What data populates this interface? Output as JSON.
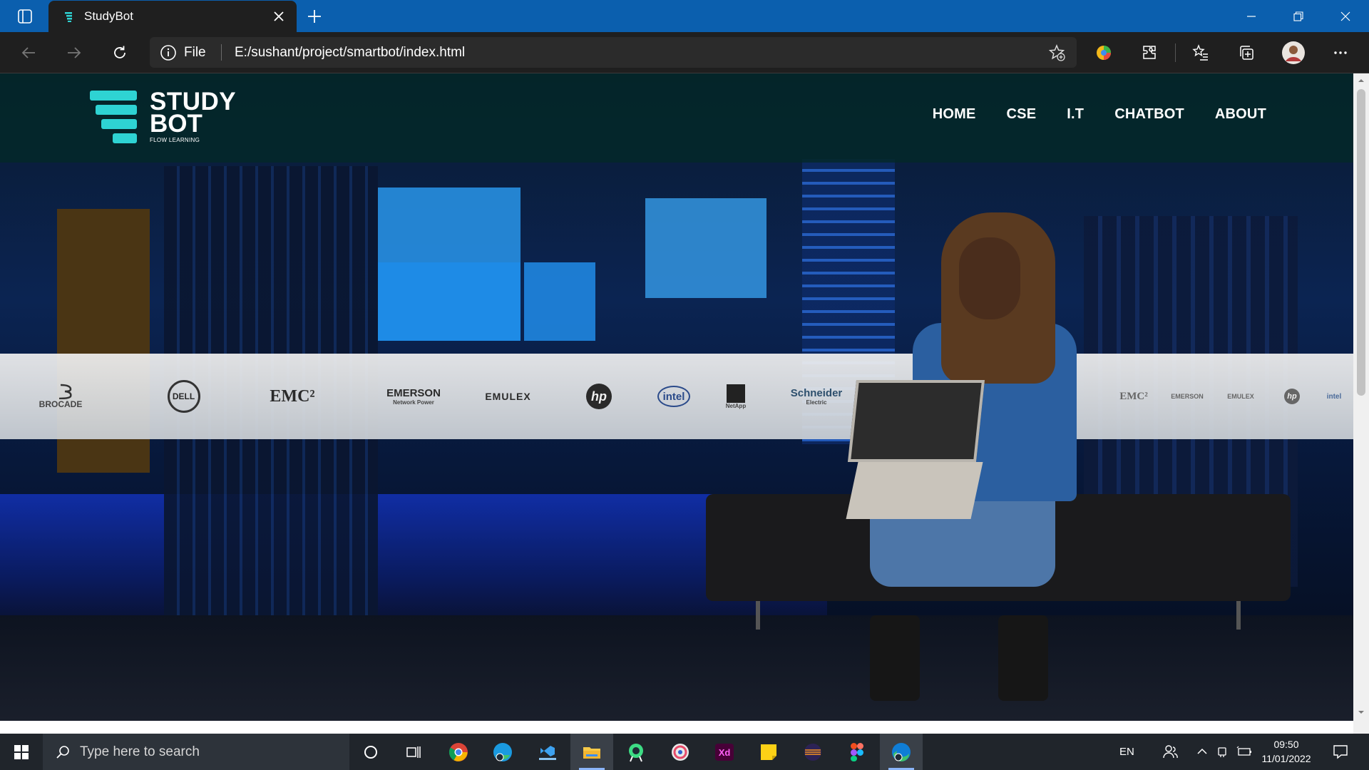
{
  "browser": {
    "tab_title": "StudyBot",
    "site_info_label": "File",
    "url": "E:/sushant/project/smartbot/index.html"
  },
  "site": {
    "logo": {
      "line1": "STUDY",
      "line2": "BOT",
      "tagline": "FLOW LEARNING",
      "accent_color": "#2ed3d3"
    },
    "nav": [
      "HOME",
      "CSE",
      "I.T",
      "CHATBOT",
      "ABOUT"
    ],
    "header_color": "#042828"
  },
  "hero": {
    "brand_banner": [
      {
        "name": "BROCADE",
        "icon": "brocade-logo"
      },
      {
        "name": "DELL",
        "icon": "dell-logo"
      },
      {
        "name": "EMC²",
        "icon": "emc-logo"
      },
      {
        "name": "EMERSON",
        "sub": "Network Power",
        "icon": "emerson-logo"
      },
      {
        "name": "EMULEX",
        "icon": "emulex-logo"
      },
      {
        "name": "hp",
        "icon": "hp-logo"
      },
      {
        "name": "intel",
        "icon": "intel-logo"
      },
      {
        "name": "NetApp",
        "icon": "netapp-logo"
      },
      {
        "name": "Schneider",
        "sub": "Electric",
        "icon": "schneider-logo"
      },
      {
        "name": "EMC²",
        "icon": "emc-logo"
      },
      {
        "name": "EMERSON",
        "icon": "emerson-logo"
      },
      {
        "name": "EMULEX",
        "icon": "emulex-logo"
      },
      {
        "name": "hp",
        "icon": "hp-logo"
      },
      {
        "name": "intel",
        "icon": "intel-logo"
      }
    ]
  },
  "taskbar": {
    "search_placeholder": "Type here to search",
    "apps": [
      "cortana-icon",
      "task-view-icon",
      "chrome-icon",
      "edge-dev-icon",
      "vscode-icon",
      "file-explorer-icon",
      "android-studio-icon",
      "davinci-icon",
      "adobe-xd-icon",
      "sticky-notes-icon",
      "eclipse-icon",
      "figma-icon",
      "edge-icon"
    ],
    "language": "EN",
    "time": "09:50",
    "date": "11/01/2022"
  },
  "colors": {
    "titlebar": "#0b5fae",
    "toolbar": "#1f1f1f",
    "taskbar": "#20252b"
  }
}
